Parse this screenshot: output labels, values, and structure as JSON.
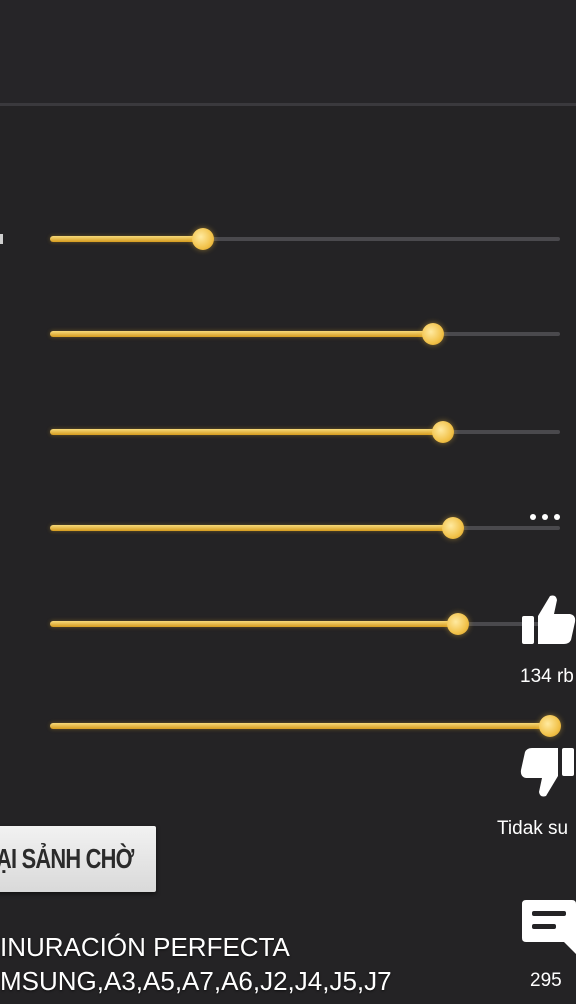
{
  "sliders": [
    {
      "name": "sensitivity-slider-1",
      "value_percent": 30
    },
    {
      "name": "sensitivity-slider-2",
      "value_percent": 75
    },
    {
      "name": "sensitivity-slider-3",
      "value_percent": 77
    },
    {
      "name": "sensitivity-slider-4",
      "value_percent": 79
    },
    {
      "name": "sensitivity-slider-5",
      "value_percent": 80
    },
    {
      "name": "sensitivity-slider-6",
      "value_percent": 98
    }
  ],
  "lobby_button": {
    "label": "ẠI SẢNH CHỜ"
  },
  "caption": {
    "line1": "INURACIÓN PERFECTA",
    "line2": "MSUNG,A3,A5,A7,A6,J2,J4,J5,J7"
  },
  "actions": {
    "like_count": "134 rb",
    "dislike_label": "Tidak su",
    "comment_count": "295"
  },
  "icons": {
    "more": "more-horizontal-icon",
    "like": "thumbs-up-icon",
    "dislike": "thumbs-down-icon",
    "comment": "comment-icon"
  },
  "colors": {
    "background": "#242325",
    "accent": "#f2c24a",
    "track": "#4a494d"
  }
}
